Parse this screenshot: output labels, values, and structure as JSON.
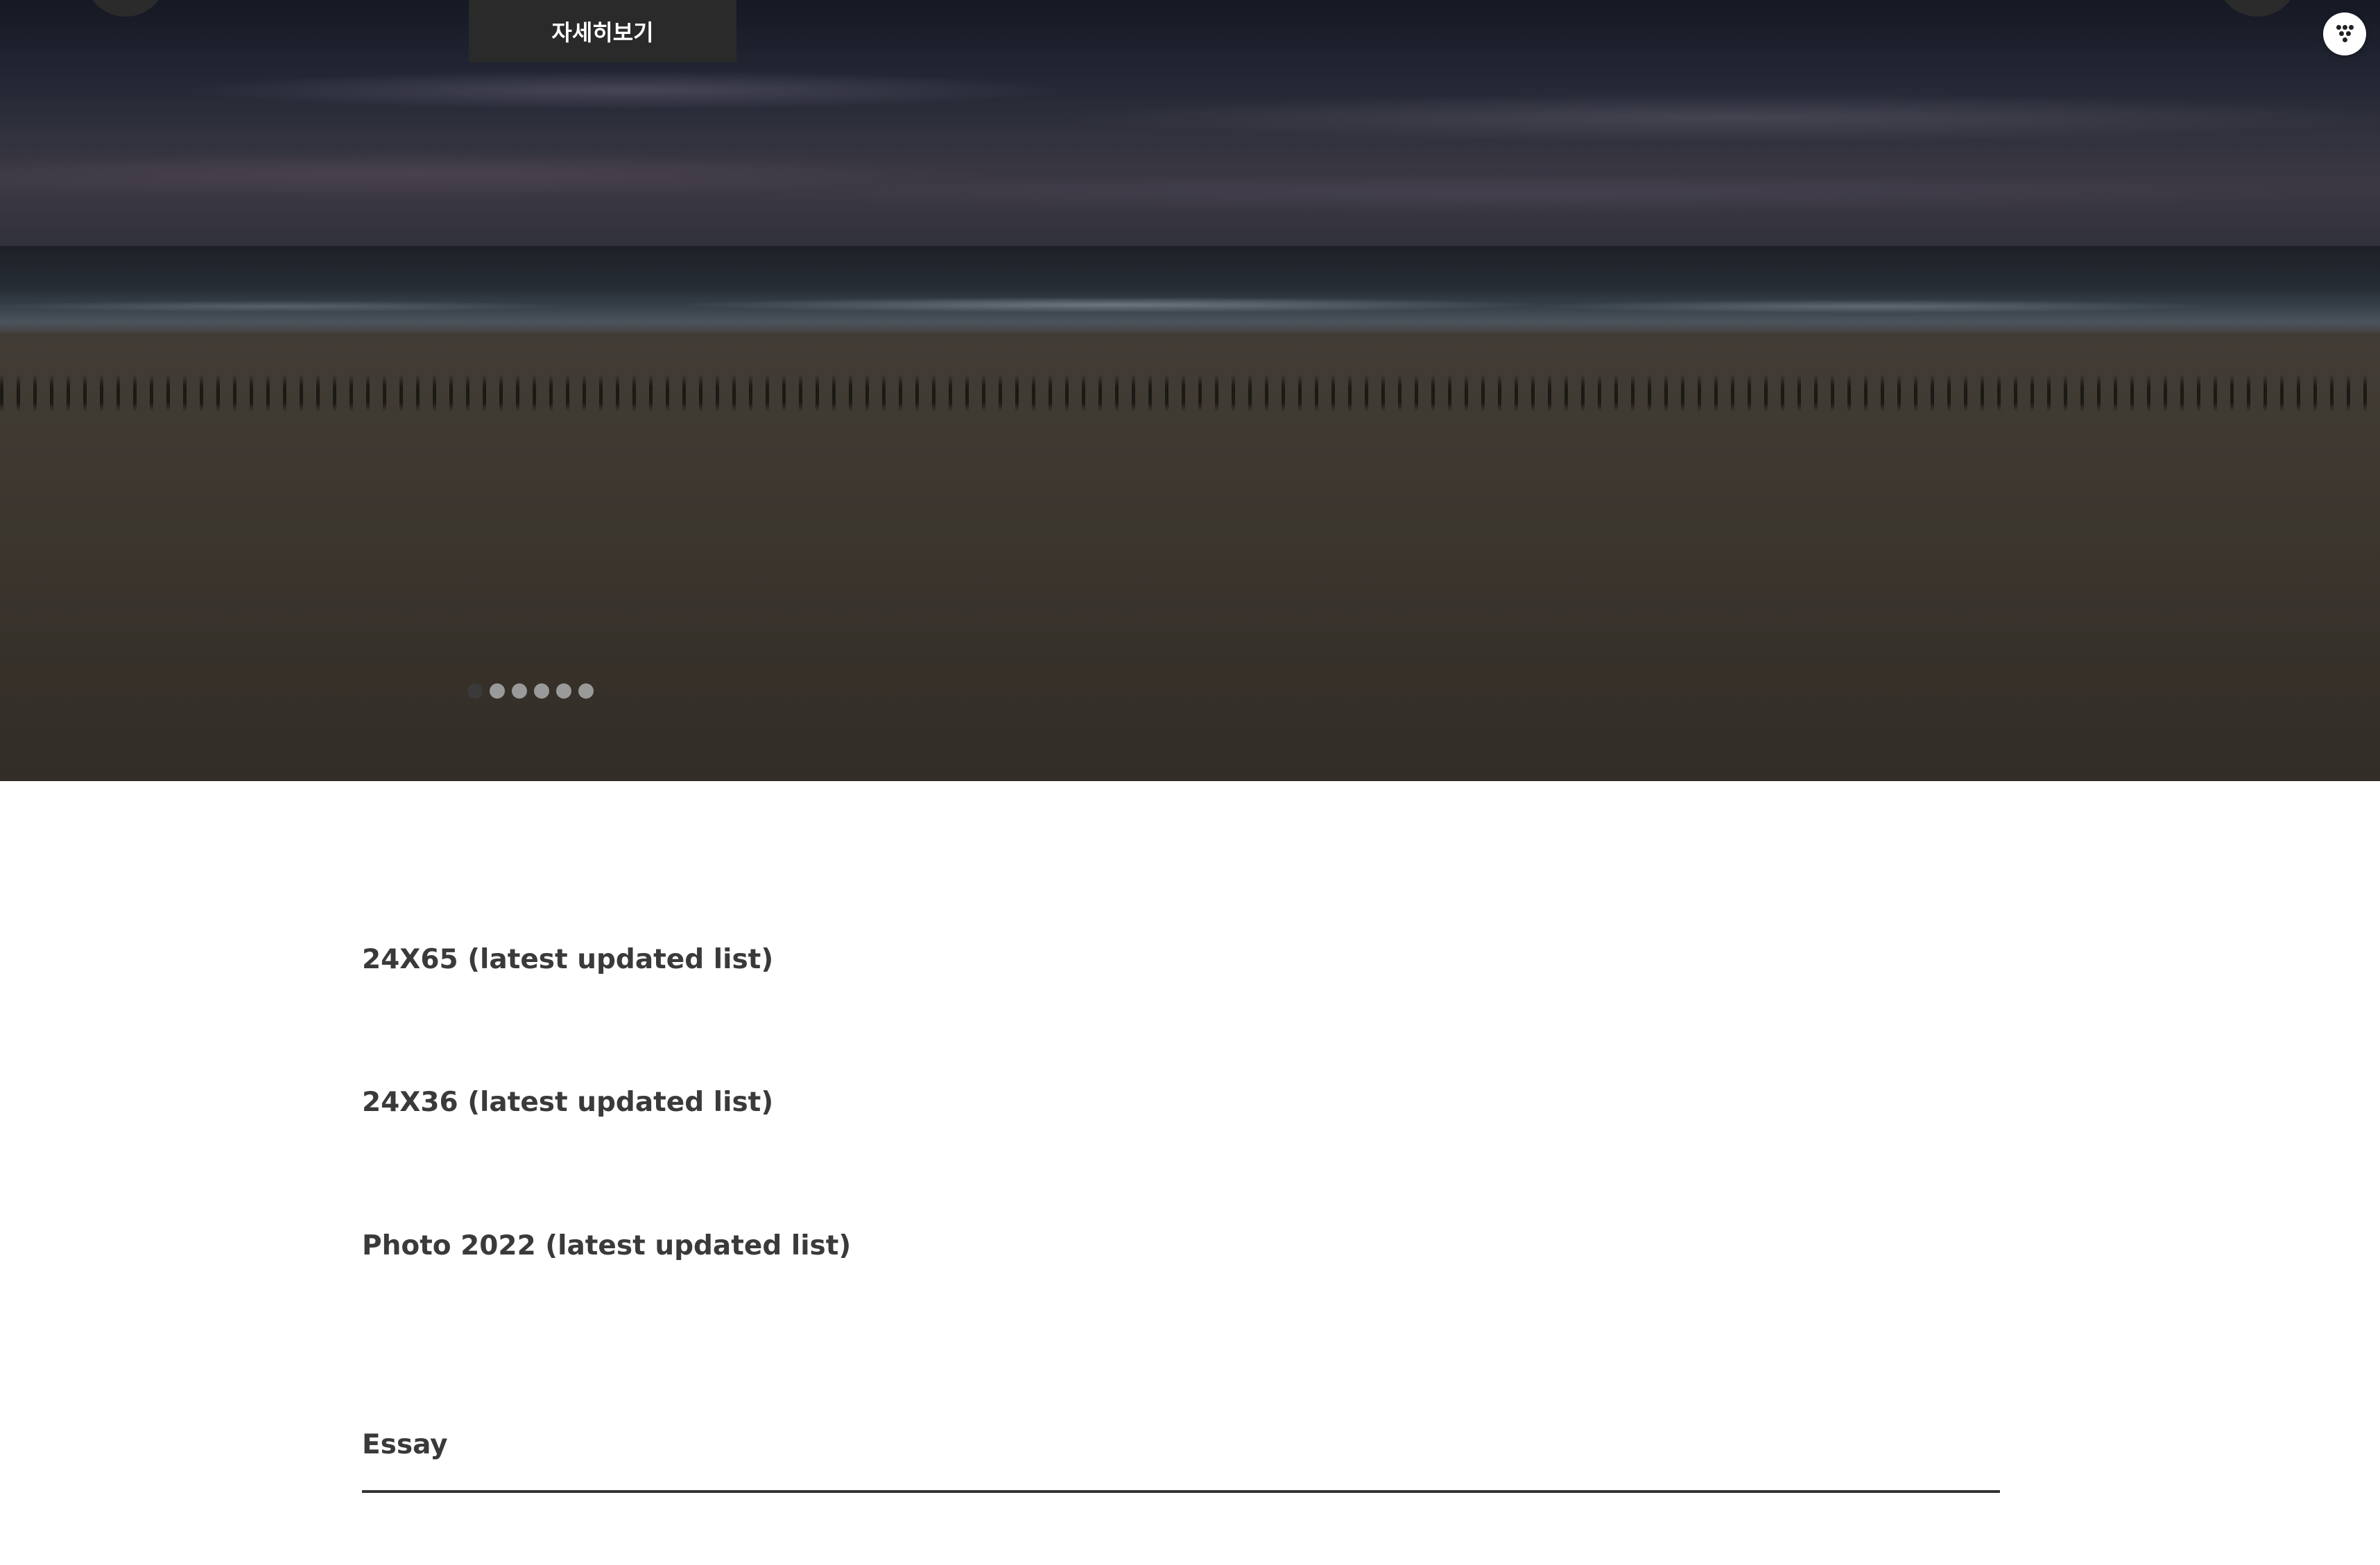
{
  "hero": {
    "detail_button_label": "자세히보기",
    "slide_count": 6,
    "active_slide_index": 0
  },
  "sections": {
    "links": [
      {
        "label": "24X65 (latest updated list)"
      },
      {
        "label": "24X36 (latest updated list)"
      },
      {
        "label": "Photo 2022 (latest updated list)"
      }
    ],
    "essay_title": "Essay"
  },
  "icons": {
    "prev": "chevron-left-icon",
    "next": "chevron-right-icon",
    "menu": "dots-grid-icon"
  },
  "colors": {
    "text": "#3a3a3a",
    "button_bg": "#2a2a2a",
    "rule": "#333333"
  }
}
